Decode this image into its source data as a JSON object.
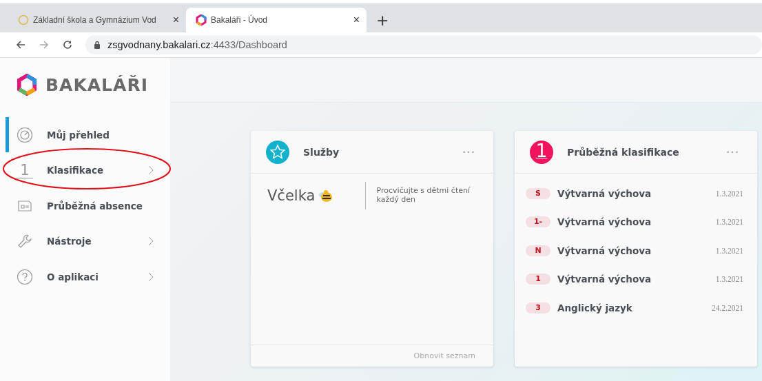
{
  "browser": {
    "tabs": [
      {
        "title": "Základní škola a Gymnázium Vod",
        "selected": false,
        "close": "×"
      },
      {
        "title": "Bakaláři - Úvod",
        "selected": true,
        "close": "×"
      }
    ],
    "new_tab": "+",
    "url_host": "zsgvodnany.bakalari.cz",
    "url_path": ":4433/Dashboard"
  },
  "brand": "BAKALÁŘI",
  "sidebar": {
    "items": [
      {
        "label": "Můj přehled",
        "kind": "gauge",
        "selected": true,
        "expandable": false
      },
      {
        "label": "Klasifikace",
        "kind": "grade",
        "icon_text": "1",
        "selected": false,
        "expandable": true
      },
      {
        "label": "Průběžná absence",
        "kind": "card",
        "selected": false,
        "expandable": false
      },
      {
        "label": "Nástroje",
        "kind": "wrench",
        "selected": false,
        "expandable": true
      },
      {
        "label": "O aplikaci",
        "kind": "help",
        "selected": false,
        "expandable": true
      }
    ]
  },
  "services": {
    "title": "Služby",
    "menu": "•••",
    "items": [
      {
        "name": "Včelka",
        "description": "Procvičujte s dětmi čtení každý den"
      }
    ],
    "footer": "Obnovit seznam"
  },
  "grades": {
    "title": "Průběžná klasifikace",
    "icon_text": "1",
    "menu": "•••",
    "rows": [
      {
        "mark": "S",
        "subject": "Výtvarná výchova",
        "date": "1.3.2021"
      },
      {
        "mark": "1-",
        "subject": "Výtvarná výchova",
        "date": "1.3.2021"
      },
      {
        "mark": "N",
        "subject": "Výtvarná výchova",
        "date": "1.3.2021"
      },
      {
        "mark": "1",
        "subject": "Výtvarná výchova",
        "date": "1.3.2021"
      },
      {
        "mark": "3",
        "subject": "Anglický jazyk",
        "date": "24.2.2021"
      }
    ]
  }
}
